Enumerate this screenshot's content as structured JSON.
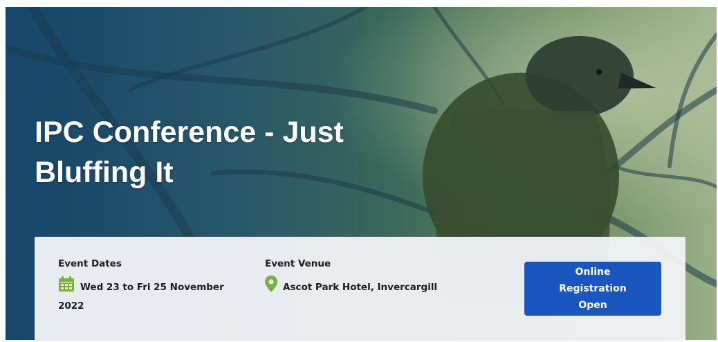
{
  "hero": {
    "title": "IPC Conference - Just Bluffing It",
    "background_image": "bird-on-branch-photo"
  },
  "event": {
    "dates_label": "Event Dates",
    "dates_value": "Wed 23 to Fri 25 November 2022",
    "dates_icon": "calendar-icon",
    "venue_label": "Event Venue",
    "venue_value": "Ascot Park Hotel, Invercargill",
    "venue_icon": "map-pin-icon"
  },
  "registration": {
    "button_label": "Online Registration Open"
  },
  "colors": {
    "button": "#1a56c0",
    "icon_green": "#7bb13a",
    "card": "#f0f2f6"
  }
}
